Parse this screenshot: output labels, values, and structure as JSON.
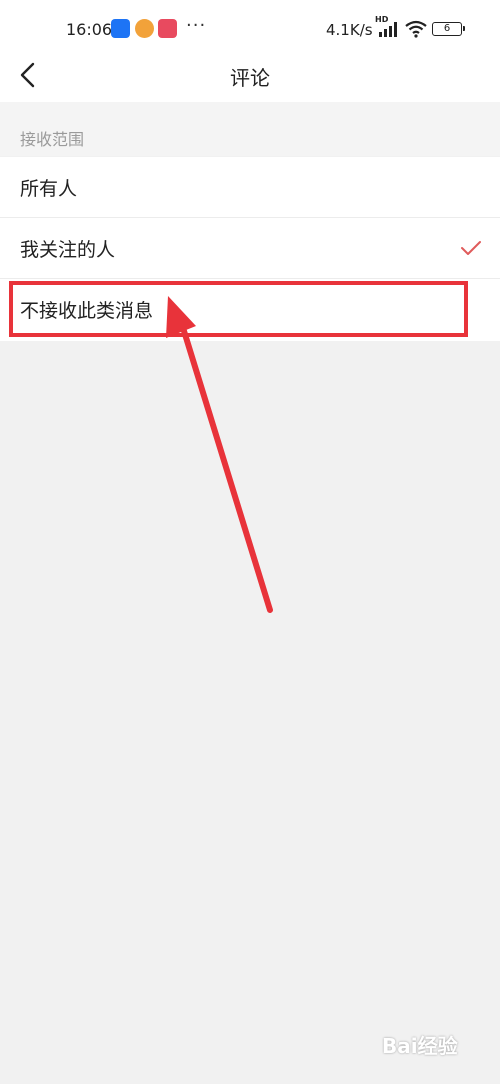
{
  "status_bar": {
    "time": "16:06",
    "dots": "···",
    "net_speed": "4.1K/s",
    "hd": "HD",
    "battery": "6",
    "app_icon_colors": [
      "#1d74f5",
      "#f2a23a",
      "#e84a5f"
    ]
  },
  "nav": {
    "title": "评论",
    "back_icon": "chevron-left-icon"
  },
  "section": {
    "label": "接收范围"
  },
  "options": [
    {
      "label": "所有人",
      "selected": false
    },
    {
      "label": "我关注的人",
      "selected": true
    },
    {
      "label": "不接收此类消息",
      "selected": false
    }
  ],
  "colors": {
    "accent_check": "#e05b5b",
    "annotation_red": "#e8333a"
  },
  "watermark": "Bai经验"
}
